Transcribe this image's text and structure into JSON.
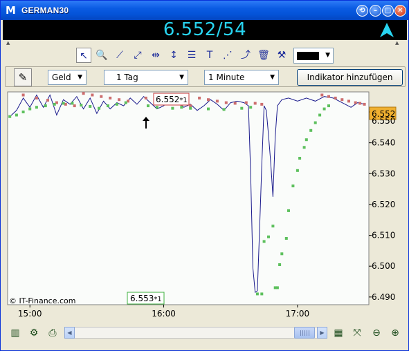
{
  "window": {
    "title": "GERMAN30",
    "icon": "m-logo-icon"
  },
  "quote": {
    "text": "6.552/54",
    "trend": "up-arrow-icon",
    "color": "#28D4F0"
  },
  "toolbar": {
    "icons": [
      "pointer-icon",
      "zoom-icon",
      "line-icon",
      "trend-line-icon",
      "horizontal-line-icon",
      "vertical-line-icon",
      "fibonacci-icon",
      "text-icon",
      "channel-icon",
      "ray-icon",
      "trash-icon",
      "tools-icon"
    ],
    "line_color": "#000000"
  },
  "options": {
    "price_type": "Geld",
    "period": "1 Tag",
    "interval": "1 Minute",
    "add_indicator": "Indikator hinzufügen"
  },
  "chart": {
    "current_price_label": "6.552",
    "overlap_label": "6.550",
    "copyright": "© IT-Finance.com",
    "top_marker": {
      "text": "6.552",
      "suffix": "*1"
    },
    "bottom_marker": {
      "text": "6.553",
      "suffix": "*1"
    },
    "colors": {
      "line": "#1A1A8C",
      "sar_above": "#CD6E6E",
      "sar_below": "#5DC05D",
      "current": "#F0B030"
    }
  },
  "chart_data": {
    "type": "line",
    "title": "",
    "x_ticks": [
      "15:00",
      "16:00",
      "17:00"
    ],
    "y_ticks": [
      "6.490",
      "6.500",
      "6.510",
      "6.520",
      "6.530",
      "6.540",
      "6.550"
    ],
    "ylim": [
      6.4875,
      6.5565
    ],
    "xlim_minutes": [
      -10,
      152
    ],
    "series": [
      {
        "kind": "line",
        "points": [
          [
            -9,
            6.5485
          ],
          [
            -6,
            6.5505
          ],
          [
            -3,
            6.5545
          ],
          [
            0,
            6.5515
          ],
          [
            3,
            6.5555
          ],
          [
            6,
            6.5515
          ],
          [
            9,
            6.5555
          ],
          [
            12,
            6.549
          ],
          [
            15,
            6.554
          ],
          [
            18,
            6.5525
          ],
          [
            21,
            6.555
          ],
          [
            24,
            6.551
          ],
          [
            27,
            6.5545
          ],
          [
            30,
            6.5495
          ],
          [
            33,
            6.5535
          ],
          [
            36,
            6.551
          ],
          [
            39,
            6.553
          ],
          [
            42,
            6.552
          ],
          [
            45,
            6.5545
          ],
          [
            48,
            6.5525
          ],
          [
            51,
            6.555
          ],
          [
            54,
            6.553
          ],
          [
            57,
            6.551
          ],
          [
            60,
            6.552
          ],
          [
            63,
            6.5545
          ],
          [
            66,
            6.5535
          ],
          [
            69,
            6.5515
          ],
          [
            72,
            6.5525
          ],
          [
            75,
            6.5505
          ],
          [
            78,
            6.552
          ],
          [
            81,
            6.554
          ],
          [
            84,
            6.5525
          ],
          [
            87,
            6.5505
          ],
          [
            90,
            6.553
          ],
          [
            93,
            6.5535
          ],
          [
            96,
            6.553
          ],
          [
            98,
            6.552
          ],
          [
            99,
            6.53
          ],
          [
            100,
            6.4995
          ],
          [
            101,
            6.4915
          ],
          [
            102,
            6.492
          ],
          [
            103,
            6.512
          ],
          [
            104,
            6.533
          ],
          [
            105,
            6.552
          ],
          [
            106,
            6.5505
          ],
          [
            107,
            6.5425
          ],
          [
            108,
            6.5335
          ],
          [
            109,
            6.5225
          ],
          [
            110,
            6.542
          ],
          [
            111,
            6.552
          ],
          [
            113,
            6.554
          ],
          [
            116,
            6.5545
          ],
          [
            120,
            6.5535
          ],
          [
            124,
            6.5545
          ],
          [
            128,
            6.5535
          ],
          [
            132,
            6.555
          ],
          [
            136,
            6.5545
          ],
          [
            140,
            6.553
          ],
          [
            144,
            6.5515
          ],
          [
            147,
            6.553
          ],
          [
            150,
            6.5525
          ]
        ]
      },
      {
        "kind": "sar-above",
        "points": [
          [
            -3,
            6.5555
          ],
          [
            3,
            6.5545
          ],
          [
            8,
            6.5538
          ],
          [
            12,
            6.553
          ],
          [
            16,
            6.5525
          ],
          [
            20,
            6.552
          ],
          [
            24,
            6.556
          ],
          [
            28,
            6.5555
          ],
          [
            32,
            6.555
          ],
          [
            36,
            6.5545
          ],
          [
            40,
            6.554
          ],
          [
            44,
            6.5535
          ],
          [
            52,
            6.5545
          ],
          [
            56,
            6.554
          ],
          [
            60,
            6.5535
          ],
          [
            64,
            6.553
          ],
          [
            68,
            6.5525
          ],
          [
            72,
            6.552
          ],
          [
            76,
            6.5545
          ],
          [
            80,
            6.554
          ],
          [
            84,
            6.5535
          ],
          [
            88,
            6.553
          ],
          [
            92,
            6.5528
          ],
          [
            97,
            6.553
          ],
          [
            101,
            6.5528
          ],
          [
            104,
            6.5525
          ],
          [
            131,
            6.5555
          ],
          [
            134,
            6.555
          ],
          [
            137,
            6.5545
          ],
          [
            140,
            6.554
          ],
          [
            143,
            6.5535
          ],
          [
            146,
            6.553
          ],
          [
            148,
            6.5528
          ],
          [
            150,
            6.5525
          ]
        ]
      },
      {
        "kind": "sar-below",
        "points": [
          [
            -9,
            6.5485
          ],
          [
            -6,
            6.549
          ],
          [
            -3,
            6.55
          ],
          [
            0,
            6.551
          ],
          [
            3,
            6.5515
          ],
          [
            7,
            6.552
          ],
          [
            11,
            6.5525
          ],
          [
            15,
            6.5528
          ],
          [
            19,
            6.5528
          ],
          [
            23,
            6.5522
          ],
          [
            27,
            6.5518
          ],
          [
            31,
            6.5512
          ],
          [
            35,
            6.552
          ],
          [
            39,
            6.5525
          ],
          [
            43,
            6.553
          ],
          [
            53,
            6.552
          ],
          [
            57,
            6.5515
          ],
          [
            64,
            6.5512
          ],
          [
            68,
            6.5515
          ],
          [
            72,
            6.5512
          ],
          [
            80,
            6.551
          ],
          [
            87,
            6.5508
          ],
          [
            95,
            6.5512
          ],
          [
            99,
            6.5515
          ],
          [
            102,
            6.491
          ],
          [
            104,
            6.491
          ],
          [
            105,
            6.508
          ],
          [
            107,
            6.5095
          ],
          [
            109,
            6.513
          ],
          [
            110,
            6.493
          ],
          [
            111,
            6.493
          ],
          [
            112,
            6.5005
          ],
          [
            113,
            6.504
          ],
          [
            115,
            6.509
          ],
          [
            116,
            6.518
          ],
          [
            118,
            6.526
          ],
          [
            120,
            6.531
          ],
          [
            121,
            6.535
          ],
          [
            123,
            6.5385
          ],
          [
            124,
            6.541
          ],
          [
            126,
            6.544
          ],
          [
            128,
            6.5465
          ],
          [
            130,
            6.549
          ],
          [
            132,
            6.551
          ],
          [
            134,
            6.552
          ]
        ]
      }
    ]
  },
  "bottombar": {
    "icons": [
      "bar-chart-icon",
      "chart-settings-icon",
      "print-icon",
      "chart-type-icon",
      "zoom-fit-icon",
      "zoom-out-icon",
      "zoom-in-icon"
    ]
  }
}
